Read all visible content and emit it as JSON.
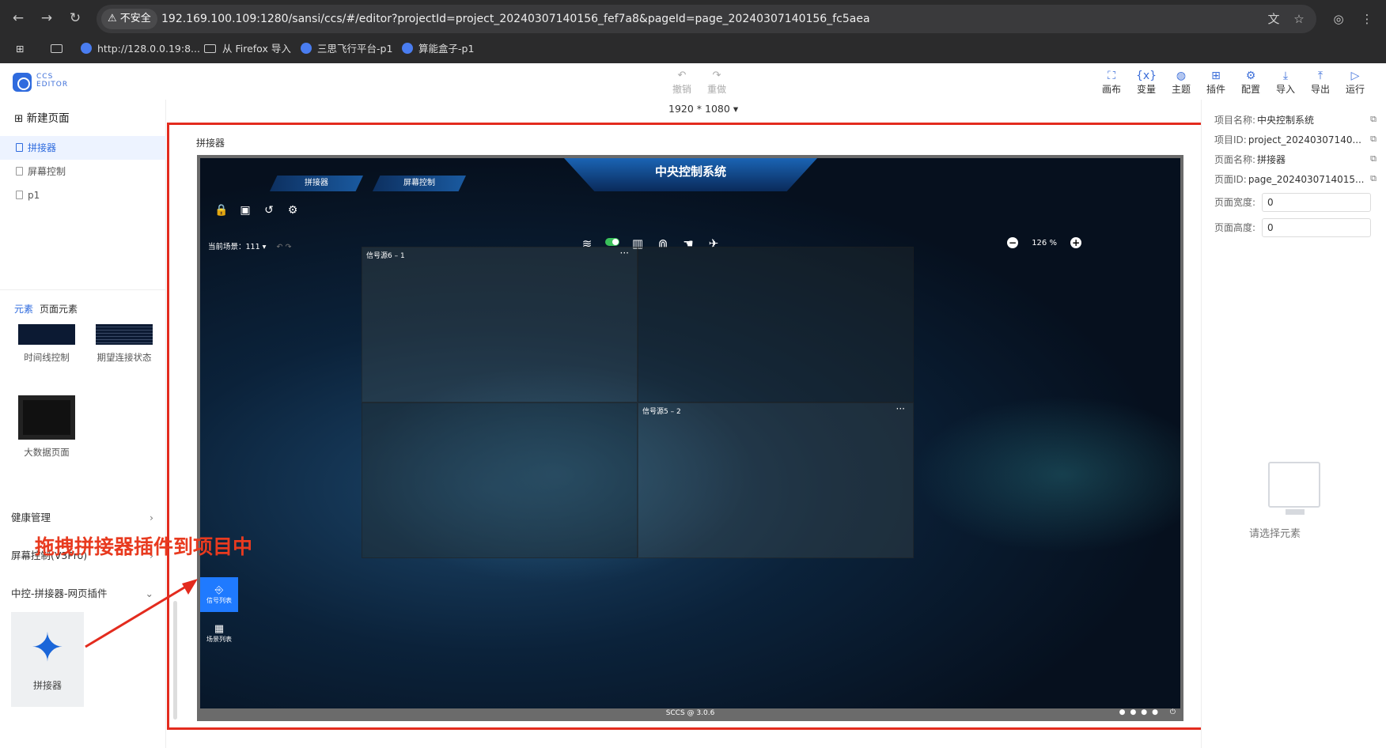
{
  "browser": {
    "back": "←",
    "forward": "→",
    "reload": "↻",
    "warning": "⚠ 不安全",
    "url": "192.169.100.109:1280/sansi/ccs/#/editor?projectId=project_20240307140156_fef7a8&pageId=page_20240307140156_fc5aea",
    "bookmarks": [
      "http://128.0.0.19:8...",
      "从 Firefox 导入",
      "三思飞行平台-p1",
      "算能盒子-p1"
    ]
  },
  "app": {
    "logo_text_1": "CCS",
    "logo_text_2": "EDITOR",
    "undo": "撤销",
    "redo": "重做",
    "toolbar": [
      "画布",
      "变量",
      "主题",
      "插件",
      "配置",
      "导入",
      "导出",
      "运行"
    ],
    "canvas_size": "1920 * 1080"
  },
  "left": {
    "new_page": "新建页面",
    "pages": [
      "拼接器",
      "屏幕控制",
      "p1"
    ],
    "tabs": [
      "元素",
      "页面元素"
    ],
    "elements": [
      "时间线控制",
      "期望连接状态",
      "大数据页面"
    ],
    "categories": [
      "健康管理",
      "屏幕控制(V3Pro)",
      "中控-拼接器-网页插件"
    ],
    "plugin_label": "拼接器"
  },
  "canvas": {
    "title": "拼接器",
    "system_title": "中央控制系统",
    "tab1": "拼接器",
    "tab2": "屏幕控制",
    "current_scene_label": "当前场景：",
    "current_scene_value": "111",
    "zoom": "126 %",
    "cell1_label": "信号源6 – 1",
    "cell4_label": "信号源5 – 2",
    "signal_list": "信号列表",
    "scene_list": "场景列表",
    "footer": "SCCS @ 3.0.6"
  },
  "annotation": "拖拽拼接器插件到项目中",
  "right": {
    "project_name_label": "项目名称:",
    "project_name": "中央控制系统",
    "project_id_label": "项目ID:",
    "project_id": "project_20240307140...",
    "page_name_label": "页面名称:",
    "page_name": "拼接器",
    "page_id_label": "页面ID:",
    "page_id": "page_2024030714015...",
    "page_width_label": "页面宽度:",
    "page_width": "0",
    "page_height_label": "页面高度:",
    "page_height": "0",
    "empty_text": "请选择元素"
  },
  "colors": {
    "accent": "#2f6bde",
    "annotation": "#e32b1e"
  }
}
